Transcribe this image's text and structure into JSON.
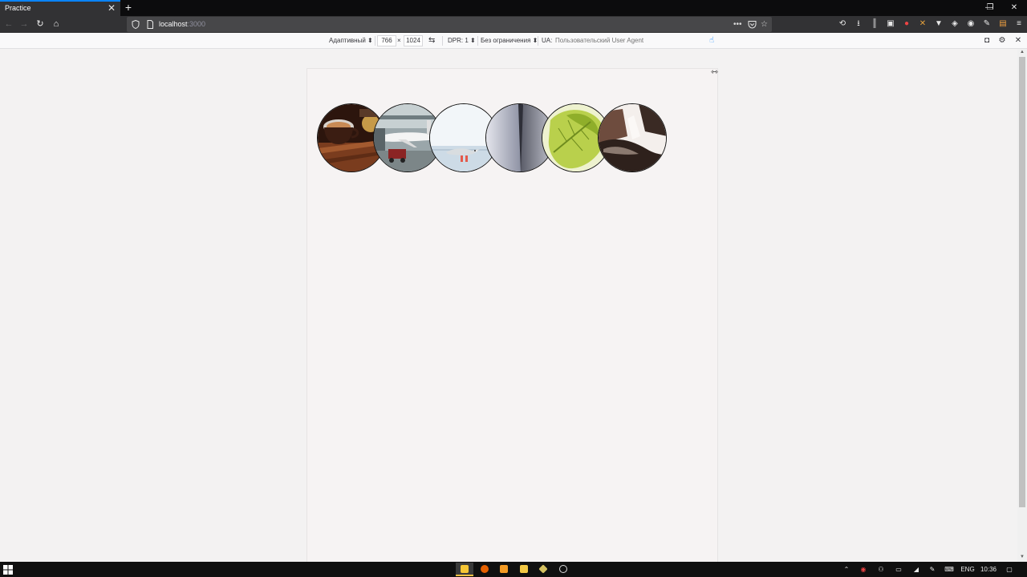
{
  "browser": {
    "tab_title": "Practice",
    "tab_close": "✕",
    "new_tab": "+",
    "window_controls": {
      "minimize": "—",
      "maximize": "❐",
      "close": "✕"
    },
    "url_host": "localhost",
    "url_port": ":3000",
    "url_actions": "•••",
    "icons": [
      "back-icon",
      "forward-icon",
      "reload-icon",
      "home-icon",
      "shield-icon",
      "page-info-icon",
      "pocket-icon",
      "star-icon",
      "history-icon",
      "download-icon",
      "library-icon",
      "sidebar-icon",
      "extension-icon",
      "account-icon",
      "menu-icon"
    ]
  },
  "rdm": {
    "device": "Адаптивный ⬍",
    "width": "766",
    "times": "×",
    "height": "1024",
    "dpr": "DPR: 1 ⬍",
    "throttle": "Без ограничения ⬍",
    "ua_label": "UA:",
    "ua_placeholder": "Пользовательский User Agent"
  },
  "page": {
    "images": [
      {
        "name": "coffee",
        "colors": [
          "#3b1f14",
          "#a0552e",
          "#e2b48a"
        ]
      },
      {
        "name": "airplane",
        "colors": [
          "#8e9a9e",
          "#f4f4f4",
          "#7a2a2a"
        ]
      },
      {
        "name": "seagull",
        "colors": [
          "#eef4f8",
          "#c9dbe8",
          "#e45a4a"
        ]
      },
      {
        "name": "building",
        "colors": [
          "#dcdde4",
          "#8e92a4",
          "#4a4c58"
        ]
      },
      {
        "name": "leaf",
        "colors": [
          "#f3f6d8",
          "#c8dc5a",
          "#6f8c1e"
        ]
      },
      {
        "name": "rock",
        "colors": [
          "#f4efec",
          "#8b5a44",
          "#2e211c"
        ]
      }
    ]
  },
  "taskbar": {
    "lang": "ENG",
    "time": "10:36"
  }
}
